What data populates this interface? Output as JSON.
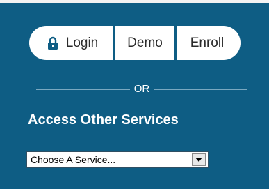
{
  "auth_buttons": {
    "login_label": "Login",
    "demo_label": "Demo",
    "enroll_label": "Enroll"
  },
  "divider": {
    "label": "OR"
  },
  "other_services": {
    "heading": "Access Other Services",
    "select_value": "Choose A Service..."
  },
  "colors": {
    "background": "#0e5d84",
    "button_fill": "#ffffff",
    "text_on_buttons": "#2b2b2b",
    "heading_text": "#ffffff"
  },
  "icons": {
    "login": "lock-icon",
    "select_arrow": "chevron-down-icon"
  }
}
